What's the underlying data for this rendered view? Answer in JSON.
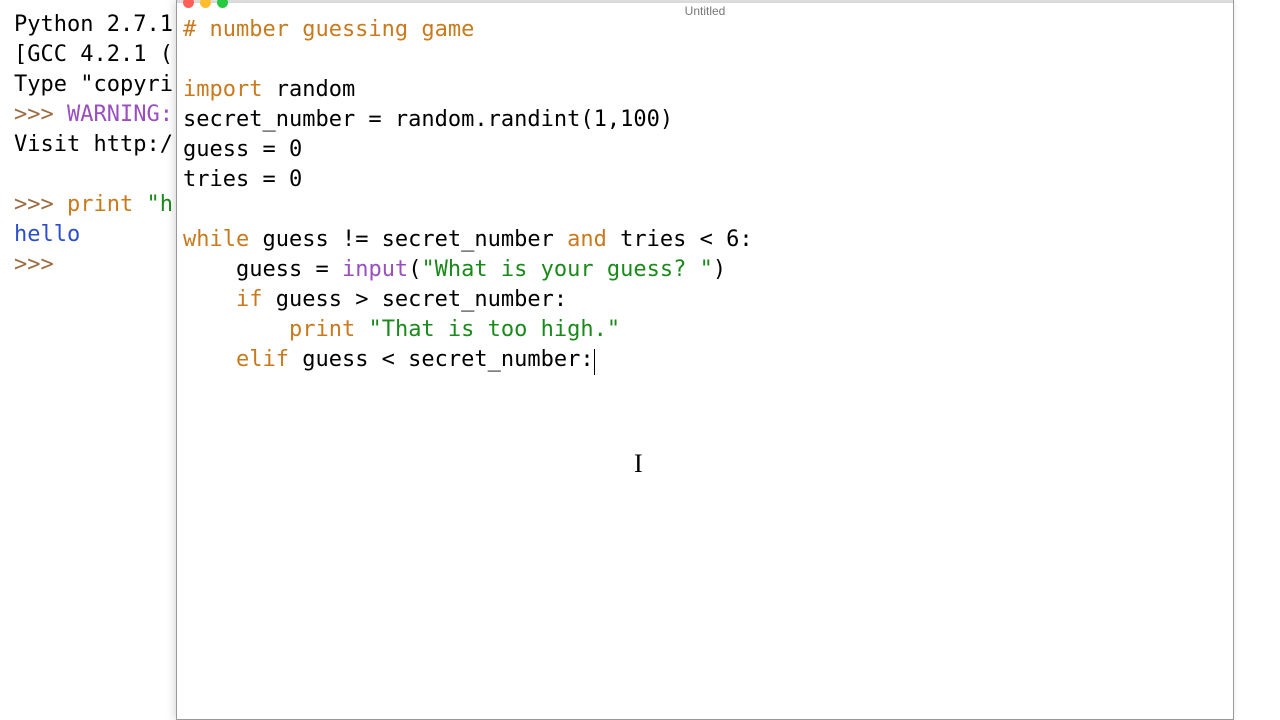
{
  "shell": {
    "line1_a": "Python 2.7.1",
    "line2_a": "[GCC 4.2.1 (",
    "line3_a": "Type \"copyri",
    "prompt": ">>> ",
    "warn_label": "WARNING:",
    "line5_a": "Visit http:/",
    "print_kw": "print",
    "print_arg": " \"h",
    "hello_out": "hello"
  },
  "editor": {
    "title": "Untitled",
    "code": {
      "comment": "# number guessing game",
      "import_kw": "import",
      "import_mod": " random",
      "l_assign1": "secret_number = random.randint(1,100)",
      "l_assign2": "guess = 0",
      "l_assign3": "tries = 0",
      "while_kw": "while",
      "while_mid": " guess != secret_number ",
      "and_kw": "and",
      "while_tail": " tries < 6:",
      "input_lead": "    guess = ",
      "input_fn": "input",
      "input_open": "(",
      "input_str": "\"What is your guess? \"",
      "input_close": ")",
      "if_kw": "    if",
      "if_tail": " guess > secret_number:",
      "print_lead": "        ",
      "print_kw": "print",
      "print_sp": " ",
      "print_str": "\"That is too high.\"",
      "elif_kw": "    elif",
      "elif_tail": " guess < secret_number:"
    }
  }
}
